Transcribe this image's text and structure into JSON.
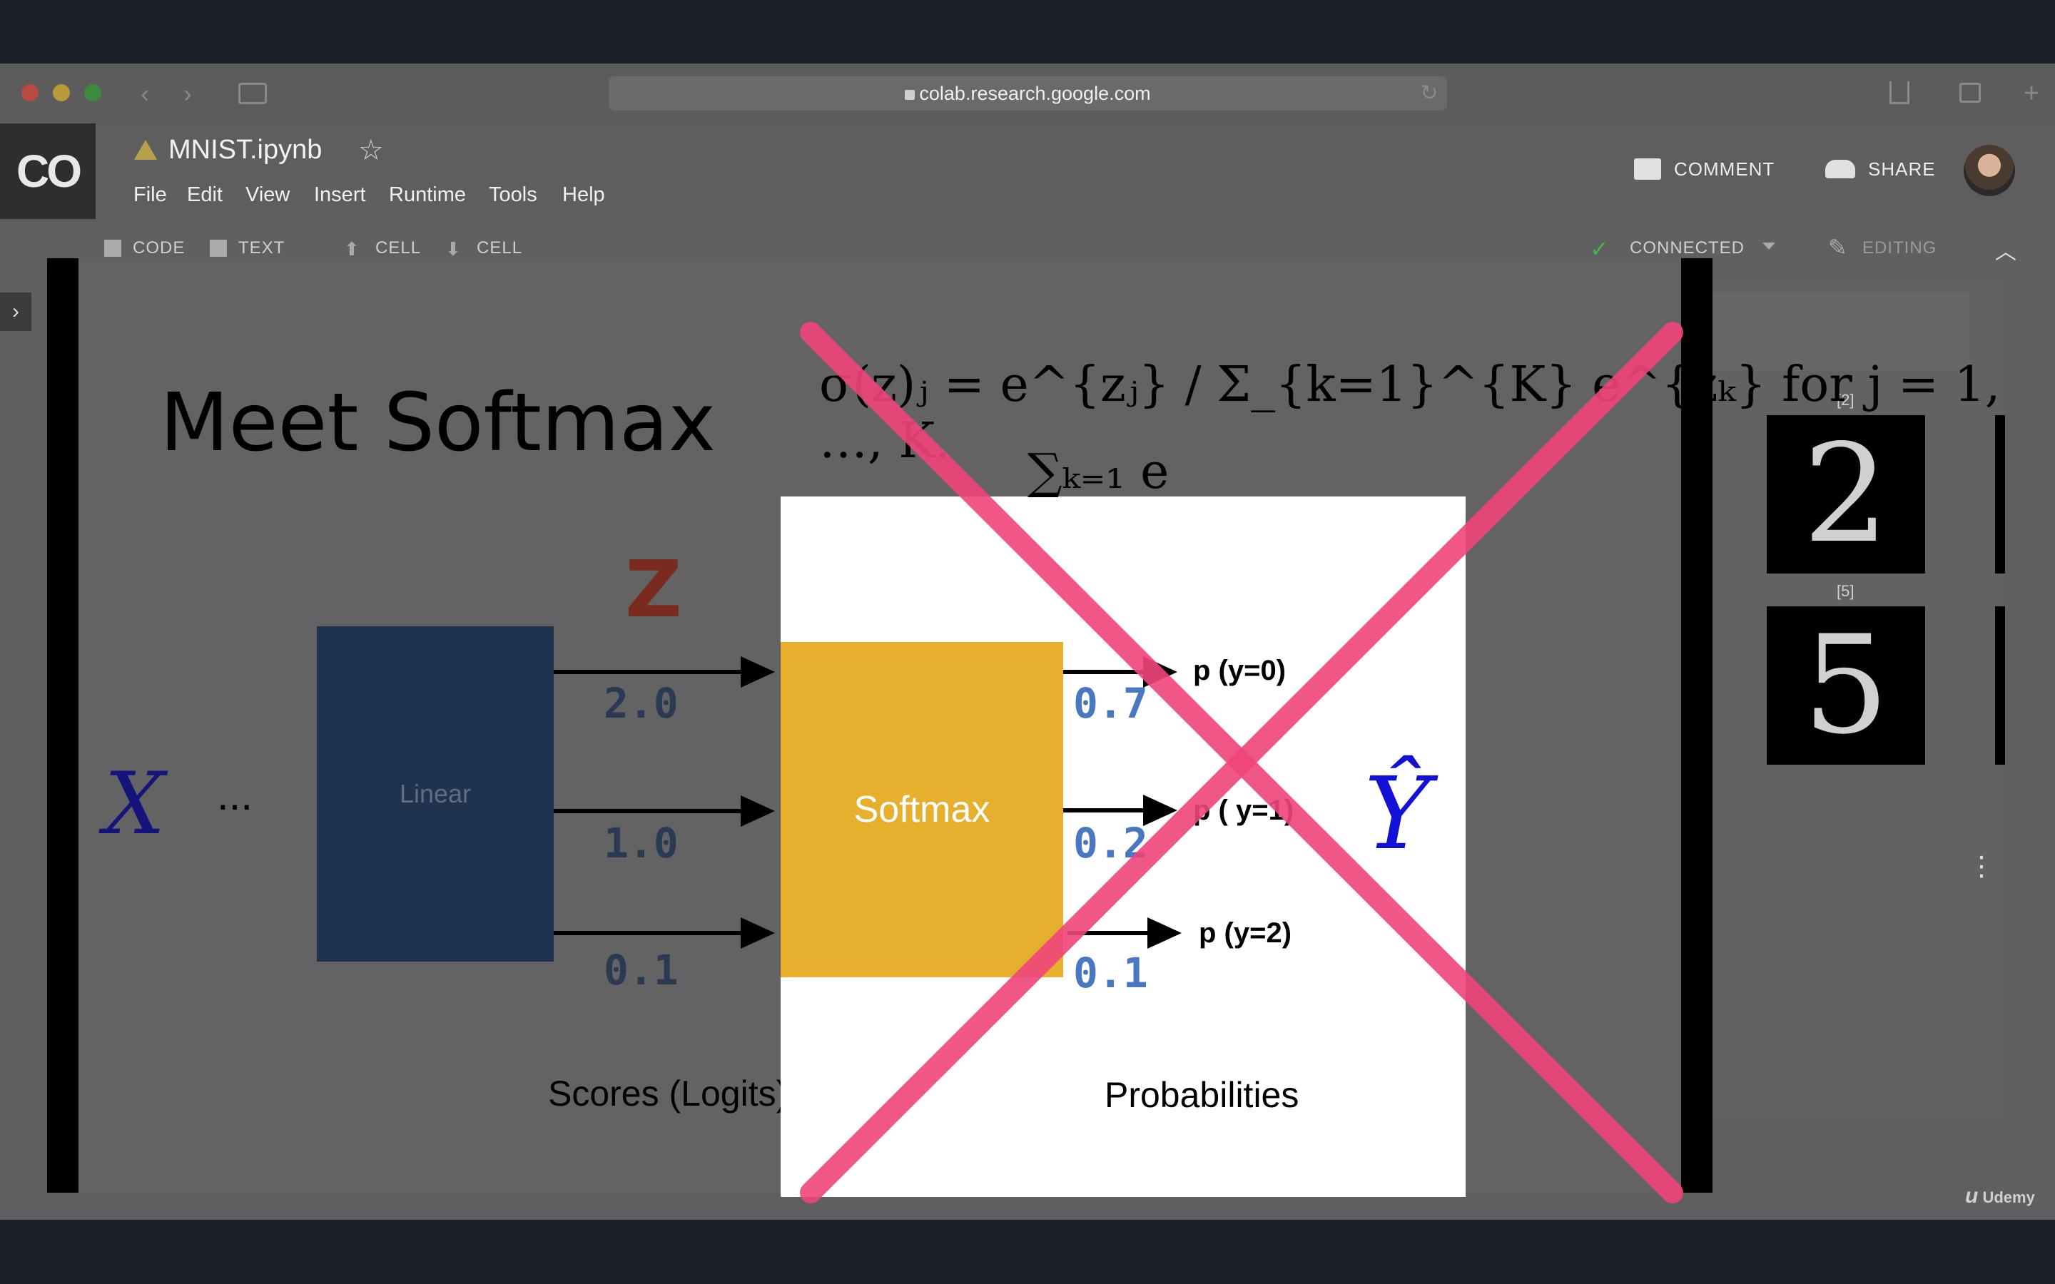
{
  "browser": {
    "url": "colab.research.google.com",
    "back_icon": "‹",
    "forward_icon": "›",
    "reload_icon": "↻",
    "traffic_colors": [
      "#ff5f57",
      "#febc2e",
      "#28c840"
    ]
  },
  "app": {
    "logo": "CO",
    "notebook_title": "MNIST.ipynb",
    "star_icon": "☆",
    "menu": [
      "File",
      "Edit",
      "View",
      "Insert",
      "Runtime",
      "Tools",
      "Help"
    ],
    "comment_label": "COMMENT",
    "share_label": "SHARE"
  },
  "toolbar": {
    "code_label": "CODE",
    "text_label": "TEXT",
    "cell_up_label": "CELL",
    "cell_down_label": "CELL",
    "connected_label": "CONNECTED",
    "editing_label": "EDITING"
  },
  "slide": {
    "title": "Meet Softmax",
    "formula": "σ(z)ⱼ = e^{zⱼ} / Σ_{k=1}^{K} e^{zₖ}   for j = 1, …, K.",
    "z_label": "Z",
    "x_label": "X",
    "dots": "...",
    "linear_label": "Linear",
    "scores": [
      "2.0",
      "1.0",
      "0.1"
    ],
    "scores_label": "Scores (Logits)",
    "softmax_label": "Softmax",
    "probs": [
      "0.7",
      "0.2",
      "0.1"
    ],
    "prob_labels": [
      "p (y=0)",
      "p ( y=1)",
      "p (y=2)"
    ],
    "yhat_label": "Ŷ",
    "probabilities_label": "Probabilities"
  },
  "notebook_output": {
    "digits": [
      {
        "caption": "[2]",
        "glyph": "2"
      },
      {
        "caption": "[5]",
        "glyph": "5"
      }
    ],
    "more_icon": "⋮"
  },
  "watermark": "Udemy",
  "cross_color": "#f0457a"
}
